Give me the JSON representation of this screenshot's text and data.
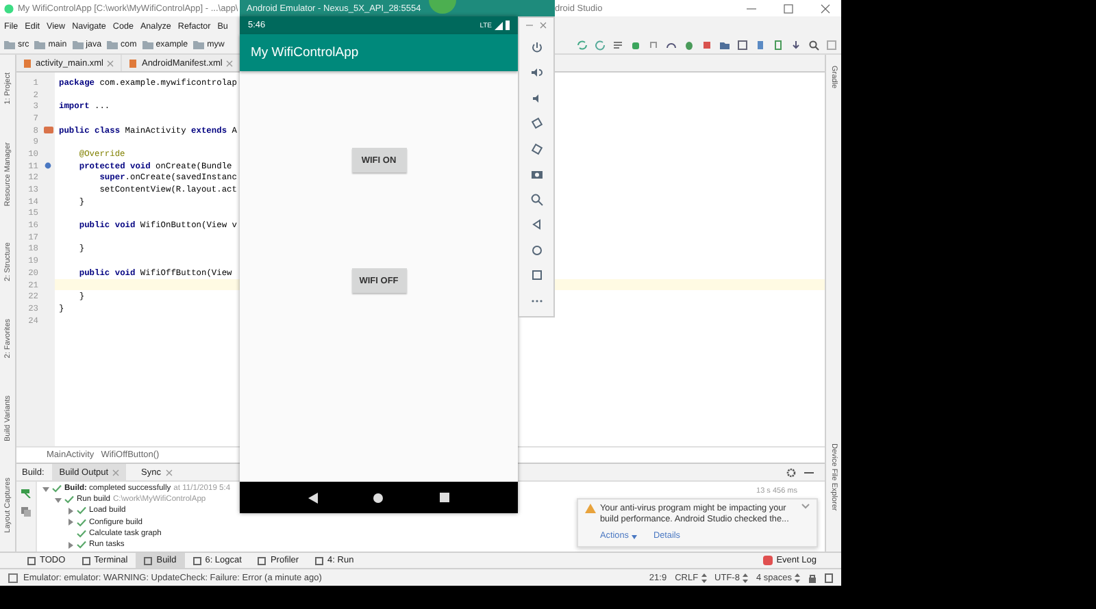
{
  "ide": {
    "title": "My WifiControlApp [C:\\work\\MyWifiControlApp] - ...\\app\\",
    "title_tail": "droid Studio",
    "menu": [
      "File",
      "Edit",
      "View",
      "Navigate",
      "Code",
      "Analyze",
      "Refactor",
      "Bu"
    ],
    "breadcrumbs": [
      "src",
      "main",
      "java",
      "com",
      "example",
      "myw"
    ],
    "tabs": [
      {
        "label": "activity_main.xml",
        "selected": false
      },
      {
        "label": "AndroidManifest.xml",
        "selected": false
      }
    ],
    "left_tools": [
      "1: Project",
      "Resource Manager",
      "2: Structure",
      "2: Favorites",
      "Build Variants",
      "Layout Captures"
    ],
    "right_tools": [
      "Gradle",
      "Device File Explorer"
    ],
    "code": [
      {
        "number": "1",
        "text": "**package** com.example.mywificontrolap",
        "kind": "code",
        "current": false
      },
      {
        "number": "2",
        "kind": "code",
        "current": false
      },
      {
        "number": "3",
        "text": "**import** ...",
        "kind": "code",
        "current": false
      },
      {
        "number": "7",
        "kind": "code",
        "current": false
      },
      {
        "number": "8",
        "text": "**public class** MainActivity **extends** A",
        "kind": "class",
        "current": false
      },
      {
        "number": "9",
        "kind": "code",
        "current": false
      },
      {
        "number": "10",
        "text": "    @Override",
        "kind": "annotation",
        "current": false
      },
      {
        "number": "11",
        "text": "    **protected void** onCreate(Bundle",
        "kind": "override",
        "current": false
      },
      {
        "number": "12",
        "text": "        **super**.onCreate(savedInstanc",
        "kind": "code",
        "current": false
      },
      {
        "number": "13",
        "text": "        setContentView(R.layout.act",
        "kind": "code",
        "current": false
      },
      {
        "number": "14",
        "text": "    }",
        "kind": "code",
        "current": false
      },
      {
        "number": "15",
        "kind": "code",
        "current": false
      },
      {
        "number": "16",
        "text": "    **public void** WifiOnButton(View v",
        "kind": "code",
        "current": false
      },
      {
        "number": "17",
        "kind": "code",
        "current": false
      },
      {
        "number": "18",
        "text": "    }",
        "kind": "code",
        "current": false
      },
      {
        "number": "19",
        "kind": "code",
        "current": false
      },
      {
        "number": "20",
        "text": "    **public void** WifiOffButton(View",
        "kind": "code",
        "current": false
      },
      {
        "number": "21",
        "kind": "code",
        "current": true
      },
      {
        "number": "22",
        "text": "    }",
        "kind": "code",
        "current": false
      },
      {
        "number": "23",
        "text": "}",
        "kind": "code",
        "current": false
      },
      {
        "number": "24",
        "kind": "code",
        "current": false
      }
    ],
    "code_path": [
      "MainActivity",
      "WifiOffButton()"
    ],
    "build": {
      "label": "Build:",
      "tabs": [
        {
          "label": "Build Output",
          "selected": true
        },
        {
          "label": "Sync",
          "selected": false
        }
      ],
      "duration": "13 s 456 ms",
      "tree": [
        {
          "label": "**Build:** completed successfully",
          "detail": "at 11/1/2019 5:4",
          "kind": "group",
          "expanded": true,
          "children": [
            {
              "label": "Run build",
              "detail": "C:\\work\\MyWifiControlApp",
              "kind": "group",
              "expanded": true,
              "children": [
                {
                  "label": "Load build",
                  "kind": "group",
                  "expanded": false
                },
                {
                  "label": "Configure build",
                  "kind": "group",
                  "expanded": false
                },
                {
                  "label": "Calculate task graph",
                  "kind": "leaf",
                  "expanded": false
                },
                {
                  "label": "Run tasks",
                  "kind": "group",
                  "expanded": false
                }
              ]
            }
          ]
        }
      ]
    },
    "tool_windows": [
      {
        "label": "TODO",
        "selected": false
      },
      {
        "label": "Terminal",
        "selected": false
      },
      {
        "label": "Build",
        "selected": true
      },
      {
        "label": "6: Logcat",
        "selected": false
      },
      {
        "label": "Profiler",
        "selected": false
      },
      {
        "label": "4: Run",
        "selected": false
      }
    ],
    "event_log": "Event Log",
    "status_message": "Emulator: emulator: WARNING: UpdateCheck: Failure: Error (a minute ago)",
    "status_items": [
      "21:9",
      "CRLF",
      "UTF-8",
      "4 spaces"
    ],
    "notification": {
      "text": "Your anti-virus program might be impacting your build performance. Android Studio checked the...",
      "actions": [
        "Actions",
        "Details"
      ]
    }
  },
  "emulator": {
    "title": "Android Emulator - Nexus_5X_API_28:5554",
    "time": "5:46",
    "network": "LTE",
    "app_title": "My WifiControlApp",
    "buttons": [
      "WIFI ON",
      "WIFI OFF"
    ]
  }
}
